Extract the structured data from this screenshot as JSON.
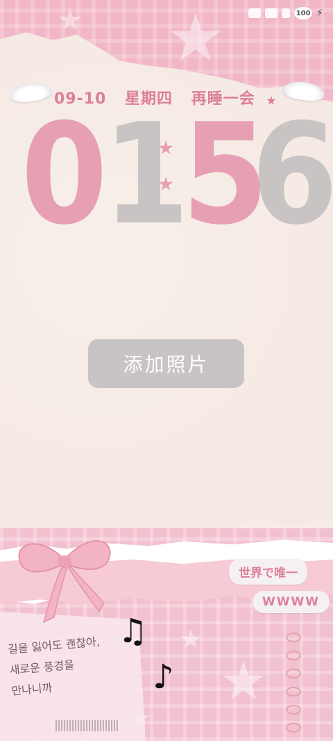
{
  "status_bar": {
    "battery_level": "100",
    "charging_icon": "bolt-icon"
  },
  "date_line": {
    "date": "09-10",
    "weekday": "星期四",
    "phrase": "再睡一会"
  },
  "clock": {
    "hour": "01",
    "minute": "56"
  },
  "add_photo": {
    "label": "添加照片"
  },
  "badges": {
    "top": "世界で唯一",
    "bottom": "WWWW"
  },
  "note_card": {
    "text": "길을 잃어도 괜찮아,\n새로운 풍경을\n만나니까"
  },
  "colors": {
    "pink_accent": "#dd7f9a",
    "digit_pink": "#e7a0b3",
    "digit_gray": "#c9c4c4",
    "button_gray": "#c8c4c3",
    "paper": "#f5eae3"
  }
}
